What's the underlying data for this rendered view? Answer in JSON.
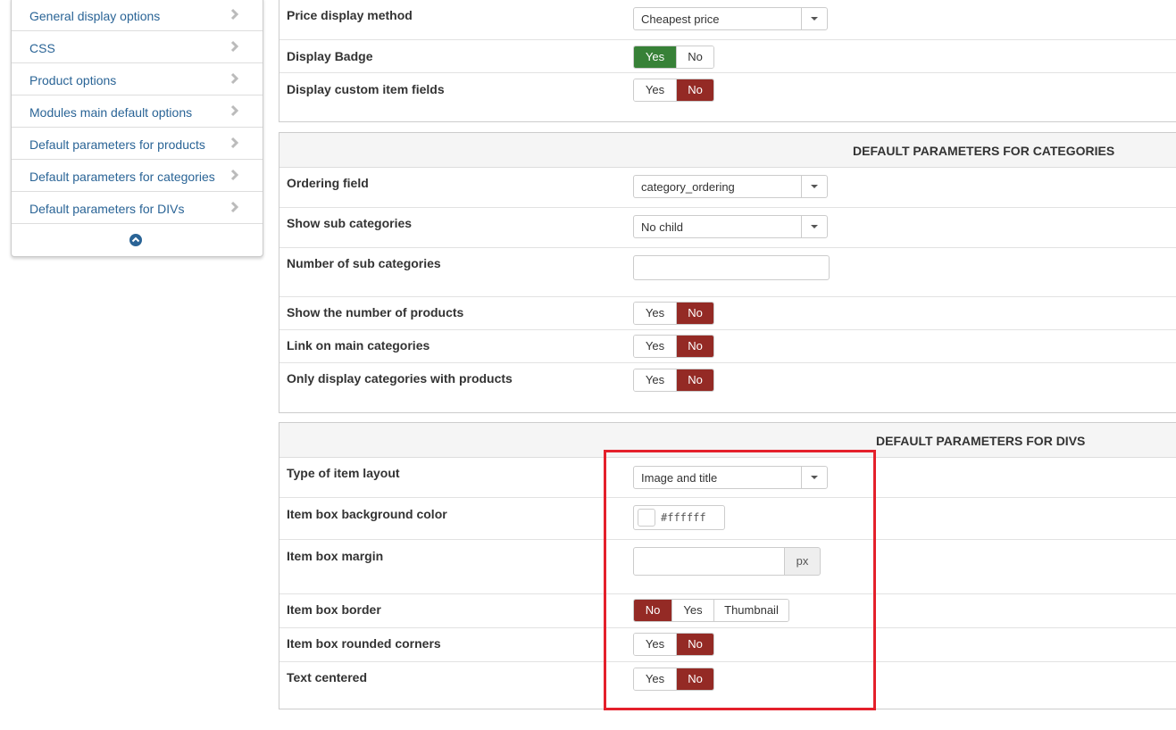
{
  "sidebar": {
    "items": [
      {
        "label": "General display options"
      },
      {
        "label": "CSS"
      },
      {
        "label": "Product options"
      },
      {
        "label": "Modules main default options"
      },
      {
        "label": "Default parameters for products"
      },
      {
        "label": "Default parameters for categories"
      },
      {
        "label": "Default parameters for DIVs"
      }
    ],
    "collapse_icon": "chevron-up-circle-icon"
  },
  "products_panel": {
    "price_display_method": {
      "label": "Price display method",
      "value": "Cheapest price"
    },
    "display_badge": {
      "label": "Display Badge",
      "yes": "Yes",
      "no": "No",
      "selected": "Yes"
    },
    "display_custom_item_fields": {
      "label": "Display custom item fields",
      "yes": "Yes",
      "no": "No",
      "selected": "No"
    }
  },
  "categories_panel": {
    "title": "DEFAULT PARAMETERS FOR CATEGORIES",
    "ordering_field": {
      "label": "Ordering field",
      "value": "category_ordering"
    },
    "show_sub_categories": {
      "label": "Show sub categories",
      "value": "No child"
    },
    "number_of_sub_categories": {
      "label": "Number of sub categories",
      "value": ""
    },
    "show_number_of_products": {
      "label": "Show the number of products",
      "yes": "Yes",
      "no": "No",
      "selected": "No"
    },
    "link_on_main_categories": {
      "label": "Link on main categories",
      "yes": "Yes",
      "no": "No",
      "selected": "No"
    },
    "only_display_with_products": {
      "label": "Only display categories with products",
      "yes": "Yes",
      "no": "No",
      "selected": "No"
    }
  },
  "divs_panel": {
    "title": "DEFAULT PARAMETERS FOR DIVS",
    "type_of_item_layout": {
      "label": "Type of item layout",
      "value": "Image and title"
    },
    "item_box_background_color": {
      "label": "Item box background color",
      "value": "#ffffff"
    },
    "item_box_margin": {
      "label": "Item box margin",
      "value": "",
      "unit": "px"
    },
    "item_box_border": {
      "label": "Item box border",
      "no": "No",
      "yes": "Yes",
      "thumbnail": "Thumbnail",
      "selected": "No"
    },
    "item_box_rounded_corners": {
      "label": "Item box rounded corners",
      "yes": "Yes",
      "no": "No",
      "selected": "No"
    },
    "text_centered": {
      "label": "Text centered",
      "yes": "Yes",
      "no": "No",
      "selected": "No"
    }
  },
  "colors": {
    "selected_no": "#942a25",
    "selected_yes": "#378137",
    "highlight_box": "#e4202b",
    "link": "#2a6496"
  }
}
